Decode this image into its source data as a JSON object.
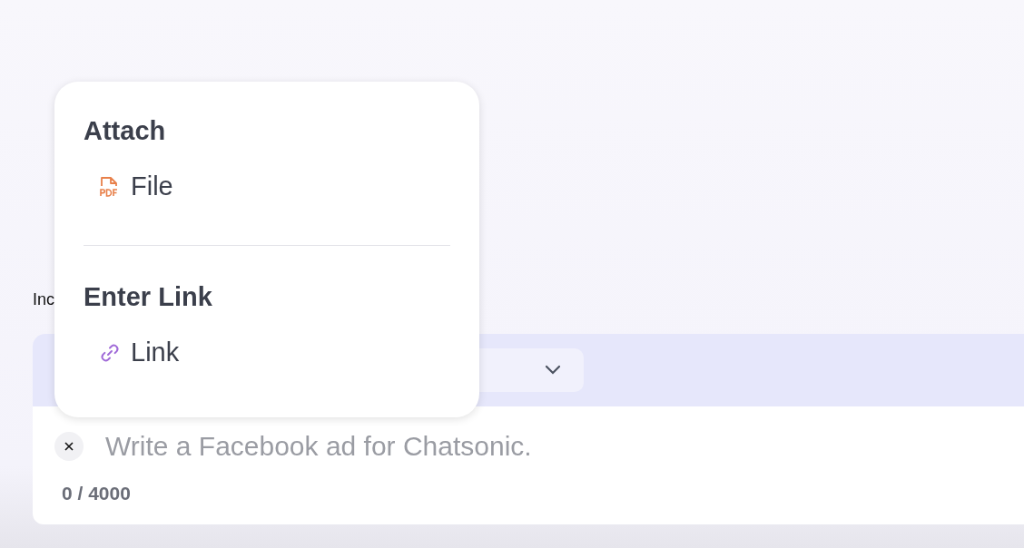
{
  "field_label": "Inc",
  "popup": {
    "sections": [
      {
        "heading": "Attach",
        "items": [
          {
            "kind": "file",
            "label": "File"
          }
        ]
      },
      {
        "heading": "Enter Link",
        "items": [
          {
            "kind": "link",
            "label": "Link"
          }
        ]
      }
    ]
  },
  "prompt": {
    "placeholder": "Write a Facebook ad for Chatsonic.",
    "counter": "0 / 4000"
  }
}
